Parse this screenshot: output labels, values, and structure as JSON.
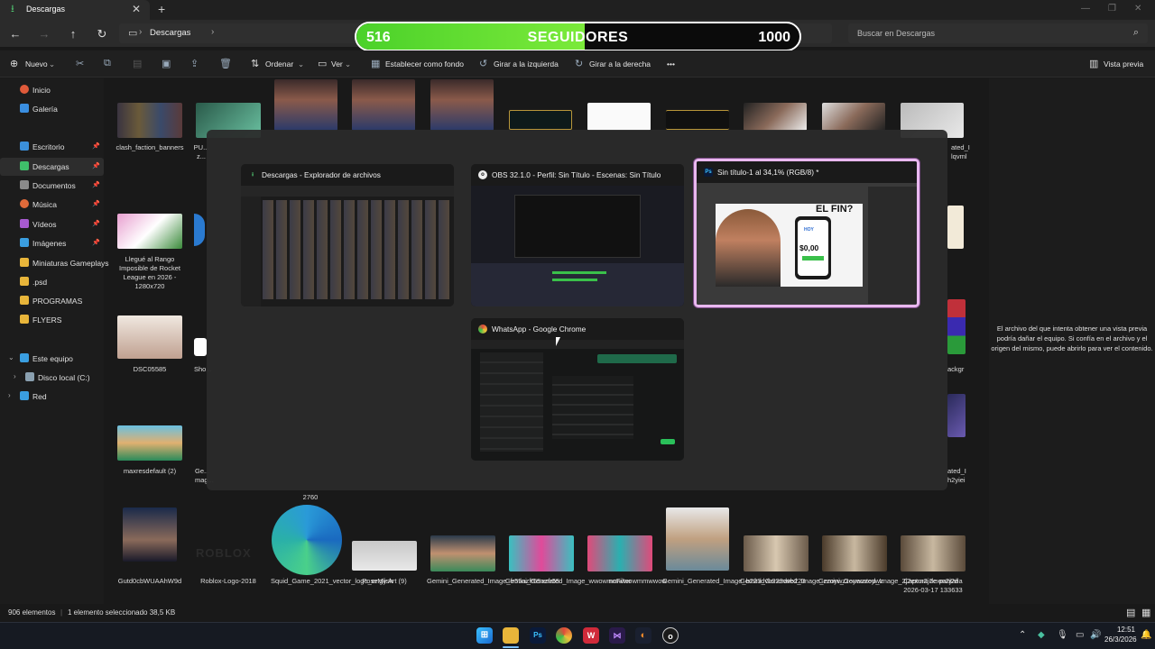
{
  "tab": {
    "title": "Descargas"
  },
  "address": {
    "crumb": "Descargas",
    "search_placeholder": "Buscar en Descargas"
  },
  "follower_bar": {
    "current": "516",
    "label": "SEGUIDORES",
    "goal": "1000",
    "progress": 0.516
  },
  "toolbar": {
    "new": "Nuevo",
    "sort": "Ordenar",
    "view": "Ver",
    "set_background": "Establecer como fondo",
    "rotate_left": "Girar a la izquierda",
    "rotate_right": "Girar a la derecha",
    "more": "•••",
    "preview": "Vista previa"
  },
  "sidebar": {
    "items": [
      {
        "label": "Inicio",
        "color": "#e05a3a"
      },
      {
        "label": "Galería",
        "color": "#3a8ee0"
      },
      {
        "label": "Escritorio",
        "color": "#3b8fd9"
      },
      {
        "label": "Descargas",
        "color": "#3fbf6a"
      },
      {
        "label": "Documentos",
        "color": "#8a8a8a"
      },
      {
        "label": "Música",
        "color": "#e06a3a"
      },
      {
        "label": "Vídeos",
        "color": "#a75ad0"
      },
      {
        "label": "Imágenes",
        "color": "#3a9ee0"
      },
      {
        "label": "Miniaturas Gameplays",
        "color": "#e8b53a"
      },
      {
        "label": ".psd",
        "color": "#e8b53a"
      },
      {
        "label": "PROGRAMAS",
        "color": "#e8b53a"
      },
      {
        "label": "FLYERS",
        "color": "#e8b53a"
      },
      {
        "label": "Este equipo",
        "color": "#3a9ee0"
      },
      {
        "label": "Disco local (C:)",
        "color": "#8aa0b0"
      },
      {
        "label": "Red",
        "color": "#3a9ee0"
      }
    ]
  },
  "files": {
    "row1": [
      {
        "name": "clash_faction_banners"
      },
      {
        "name": "PU... z..."
      },
      {
        "name": ""
      },
      {
        "name": ""
      },
      {
        "name": ""
      },
      {
        "name": ""
      },
      {
        "name": ""
      },
      {
        "name": ""
      },
      {
        "name": ""
      },
      {
        "name": ""
      },
      {
        "name": "ated_I lqvml"
      }
    ],
    "row2": [
      {
        "name": "Llegué al Rango Imposible de Rocket League en 2026 - 1280x720"
      }
    ],
    "row3": [
      {
        "name": "DSC05585"
      },
      {
        "name": "Sho..."
      },
      {
        "name": "ackgr"
      }
    ],
    "row4": [
      {
        "name": "maxresdefault (2)"
      },
      {
        "name": "Ge... mag..."
      },
      {
        "name": "ated_I h2yiei"
      }
    ],
    "row5": [
      {
        "name": "Gutd0cbWUAAhW9d"
      },
      {
        "name": "Roblox-Logo-2018"
      },
      {
        "name": "Squid_Game_2021_vector_logo_english"
      },
      {
        "name": "PoseMy.Art (9)"
      },
      {
        "name": "Gemini_Generated_Image_fr55azfr55azfr55"
      },
      {
        "name": "Gemini_Generated_Image_wwowmmwwowmmwwow"
      },
      {
        "name": "noFilter"
      },
      {
        "name": "Gemini_Generated_Image_b223dvb223dvb223"
      },
      {
        "name": "Gemini_Generated_Image_zzoywzzoywzzoywz"
      },
      {
        "name": "Gemini_Generated_Image_2j2exm2j2exm2j2e"
      },
      {
        "name": "Captura de pantalla 2026-03-17 133633"
      }
    ],
    "partial_label": "2760"
  },
  "preview_pane": {
    "message": "El archivo del que intenta obtener una vista previa podría dañar el equipo. Si confía en el archivo y el origen del mismo, puede abrirlo para ver el contenido."
  },
  "status": {
    "count": "906 elementos",
    "selected": "1 elemento seleccionado  38,5 KB"
  },
  "task_view": {
    "windows": [
      {
        "title": "Descargas - Explorador de archivos",
        "icon": "file-explorer-icon"
      },
      {
        "title": "OBS 32.1.0 - Perfil: Sin Título - Escenas: Sin Título",
        "icon": "obs-icon"
      },
      {
        "title": "Sin título-1 al 34,1% (RGB/8) *",
        "icon": "photoshop-icon"
      },
      {
        "title": "WhatsApp - Google Chrome",
        "icon": "chrome-icon"
      }
    ],
    "ps_content": {
      "heading": "EL FIN?",
      "phone_top": "HOY",
      "price": "$0,00"
    }
  },
  "clock": {
    "time": "12:51",
    "date": "26/3/2026"
  }
}
